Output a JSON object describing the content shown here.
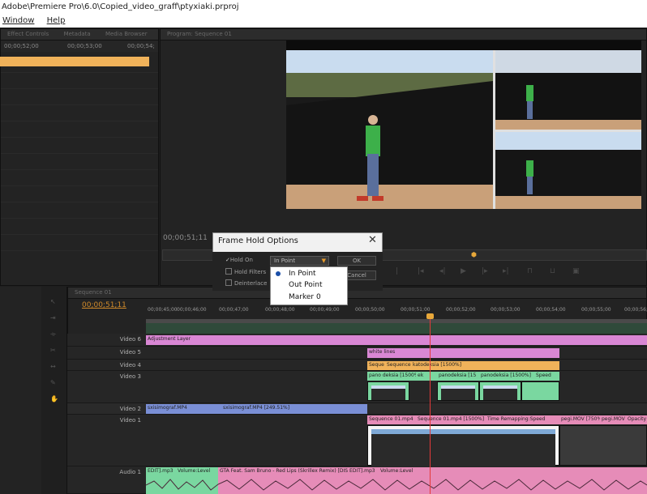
{
  "window": {
    "title": "Adobe\\Premiere Pro\\6.0\\Copied_video_graff\\ptyxiaki.prproj",
    "menu": [
      "Window",
      "Help"
    ]
  },
  "source_panel": {
    "tabs": [
      "Effect Controls",
      "Metadata",
      "Media Browser"
    ],
    "ruler": [
      "00;00;52;00",
      "00;00;53;00",
      "00;00;54;"
    ]
  },
  "program_panel": {
    "tab": "Program: Sequence 01",
    "timecode": "00;00;51;11"
  },
  "dialog": {
    "title": "Frame Hold Options",
    "close": "✕",
    "hold_on_label": "Hold On",
    "hold_filters_label": "Hold Filters",
    "deinterlace_label": "Deinterlace",
    "selected": "In Point",
    "ok": "OK",
    "cancel": "Cancel",
    "options": [
      "In Point",
      "Out Point",
      "Marker 0"
    ]
  },
  "sequence": {
    "tab": "Sequence 01",
    "timecode": "00;00;51;11",
    "ruler": [
      "00;00;45;00",
      "00;00;46;00",
      "00;00;47;00",
      "00;00;48;00",
      "00;00;49;00",
      "00;00;50;00",
      "00;00;51;00",
      "00;00;52;00",
      "00;00;53;00",
      "00;00;54;00",
      "00;00;55;00",
      "00;00;56;"
    ],
    "tracks": {
      "v6": "Video 6",
      "v5": "Video 5",
      "v4": "Video 4",
      "v3": "Video 3",
      "v2": "Video 2",
      "v1": "Video 1",
      "a1": "Audio 1"
    },
    "clips": {
      "adjustment": "Adjustment Layer",
      "white_lines": "white lines",
      "seq_a": "Seque",
      "seq_b": "Sequence",
      "katodeksia": "katodeksia [1500%]",
      "pano1": "pano deksia [1500%]",
      "pano2": "ek",
      "pano3": "panodeksia [15",
      "pano4": "panodeksia [1500%]",
      "speed": "Speed",
      "v2a": "sxisimograf.MP4",
      "v2b": "sxisimograf.MP4 [249.51%]",
      "v1a": "Sequence 01.mp4",
      "v1b": "Sequence 01.mp4 [1500%]",
      "v1c": "Time Remapping:Speed",
      "v1d": "pegi.MOV [750%]",
      "v1e": "pegi.MOV",
      "v1f": "Opacity",
      "a1a": "EDIT].mp3",
      "a1b": "Volume:Level",
      "a1c": "GTA Feat. Sam Bruno - Red Lips (Skrillex Remix) [DIS EDIT].mp3",
      "a1d": "Volume:Level"
    }
  },
  "colors": {
    "orange": "#f0b25a",
    "playhead": "#e53a3a",
    "pink": "#d987d4",
    "audio_pink": "#e68cb8",
    "green": "#7ad7a0",
    "blue": "#7a8fd6"
  }
}
